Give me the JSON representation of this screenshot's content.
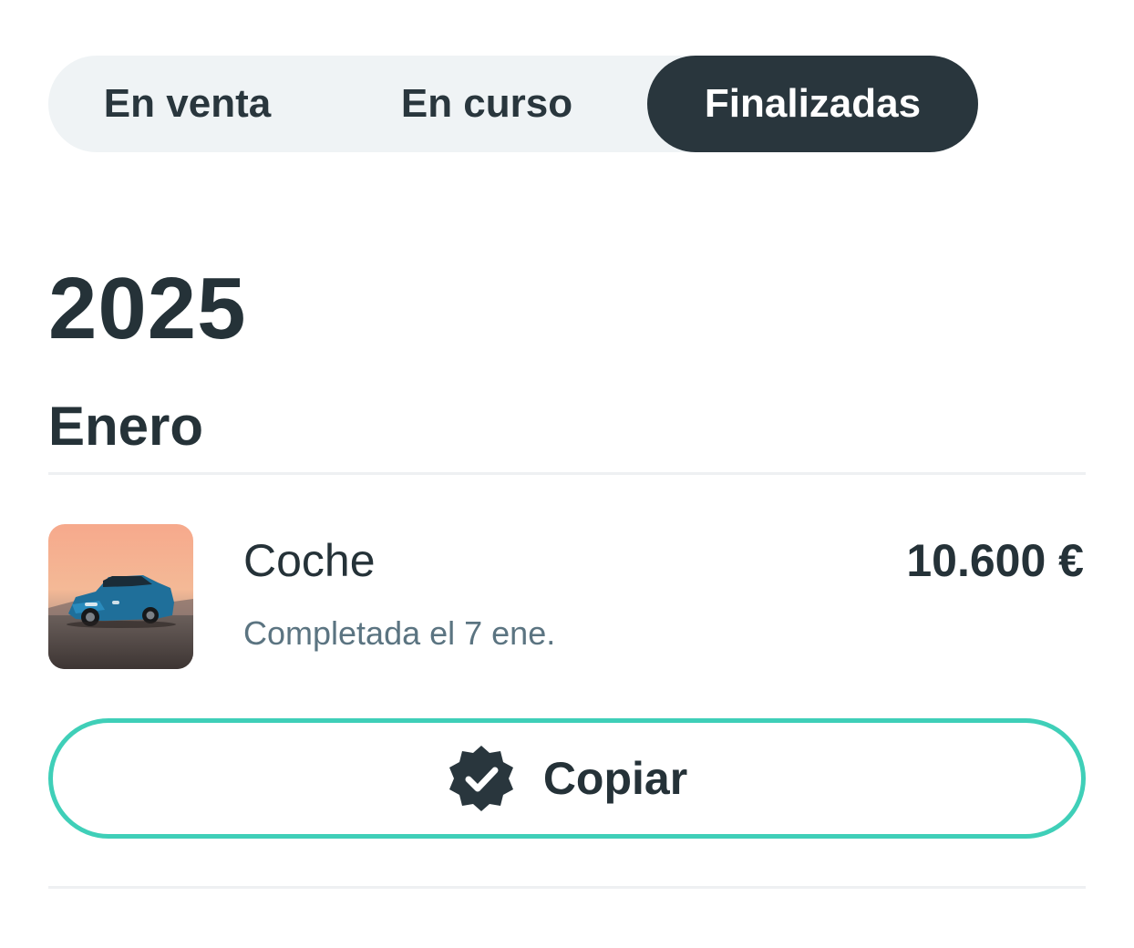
{
  "tabs": [
    {
      "label": "En venta",
      "active": false
    },
    {
      "label": "En curso",
      "active": false
    },
    {
      "label": "Finalizadas",
      "active": true
    }
  ],
  "section": {
    "year": "2025",
    "month": "Enero"
  },
  "item": {
    "title": "Coche",
    "status": "Completada el 7 ene.",
    "price": "10.600 €",
    "image_icon": "car-photo"
  },
  "copy_button": {
    "label": "Copiar",
    "icon": "verified-badge-icon"
  },
  "colors": {
    "dark": "#29363d",
    "tab_bg": "#eff3f5",
    "accent": "#3fcfb8",
    "muted": "#5b7481"
  }
}
